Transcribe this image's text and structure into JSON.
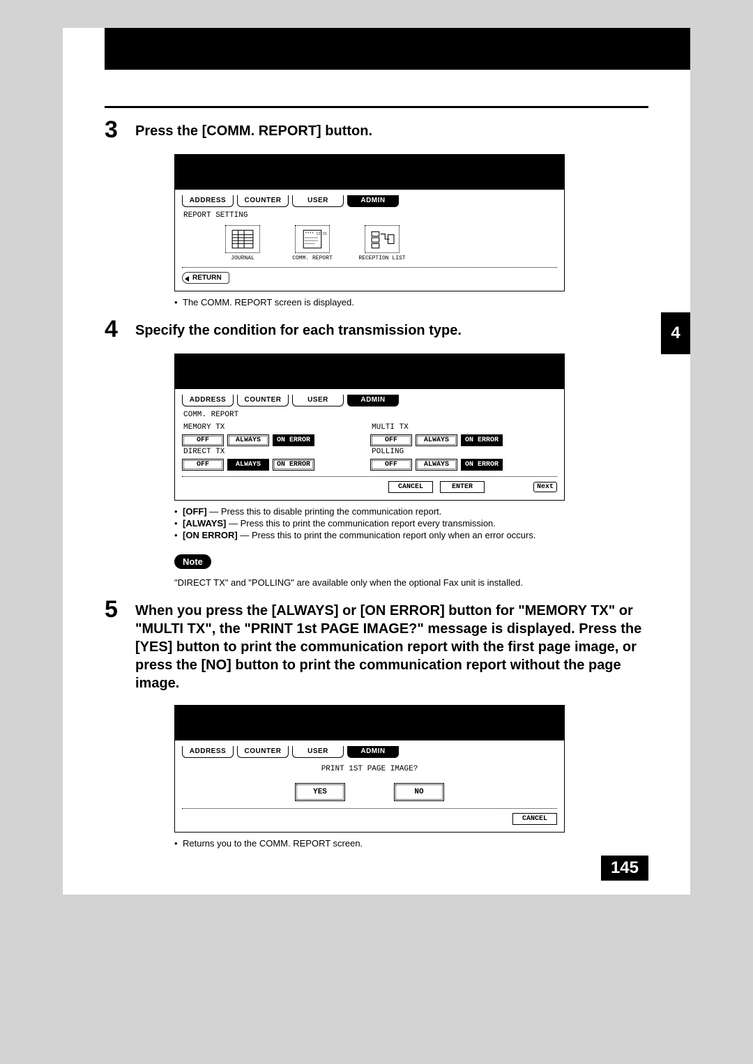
{
  "page_number": "145",
  "side_chapter": "4",
  "steps": {
    "s3": {
      "num": "3",
      "title": "Press the [COMM. REPORT] button.",
      "bullets": [
        "The COMM. REPORT screen is displayed."
      ]
    },
    "s4": {
      "num": "4",
      "title": "Specify the condition for each transmission type.",
      "bullets_b": [
        {
          "b": "[OFF]",
          "t": " — Press this to disable printing the communication report."
        },
        {
          "b": "[ALWAYS]",
          "t": " — Press this to print the communication report every transmission."
        },
        {
          "b": "[ON ERROR]",
          "t": " — Press this to print the communication report only when an error occurs."
        }
      ],
      "note_label": "Note",
      "note_text": "\"DIRECT TX\" and \"POLLING\" are available only when the optional Fax unit is installed."
    },
    "s5": {
      "num": "5",
      "title": "When you press the [ALWAYS] or [ON ERROR] button for \"MEMORY TX\" or \"MULTI TX\", the \"PRINT 1st PAGE IMAGE?\" message is displayed.  Press the [YES] button to print the communication report with the first page image, or press the [NO] button to print the communication report without the page image.",
      "bullets": [
        "Returns you to the COMM. REPORT screen."
      ]
    }
  },
  "lcd": {
    "tabs": {
      "address": "ADDRESS",
      "counter": "COUNTER",
      "user": "USER",
      "admin": "ADMIN"
    },
    "return": "RETURN",
    "cancel": "CANCEL",
    "enter": "ENTER",
    "next": "Next",
    "screen1": {
      "title": "REPORT SETTING",
      "icons": {
        "journal": "JOURNAL",
        "comm": "COMM. REPORT",
        "reception": "RECEPTION LIST"
      }
    },
    "screen2": {
      "title": "COMM. REPORT",
      "memory_tx": "MEMORY TX",
      "direct_tx": "DIRECT TX",
      "multi_tx": "MULTI TX",
      "polling": "POLLING",
      "off": "OFF",
      "always": "ALWAYS",
      "on_error": "ON ERROR"
    },
    "screen3": {
      "msg": "PRINT 1ST PAGE IMAGE?",
      "yes": "YES",
      "no": "NO"
    }
  }
}
